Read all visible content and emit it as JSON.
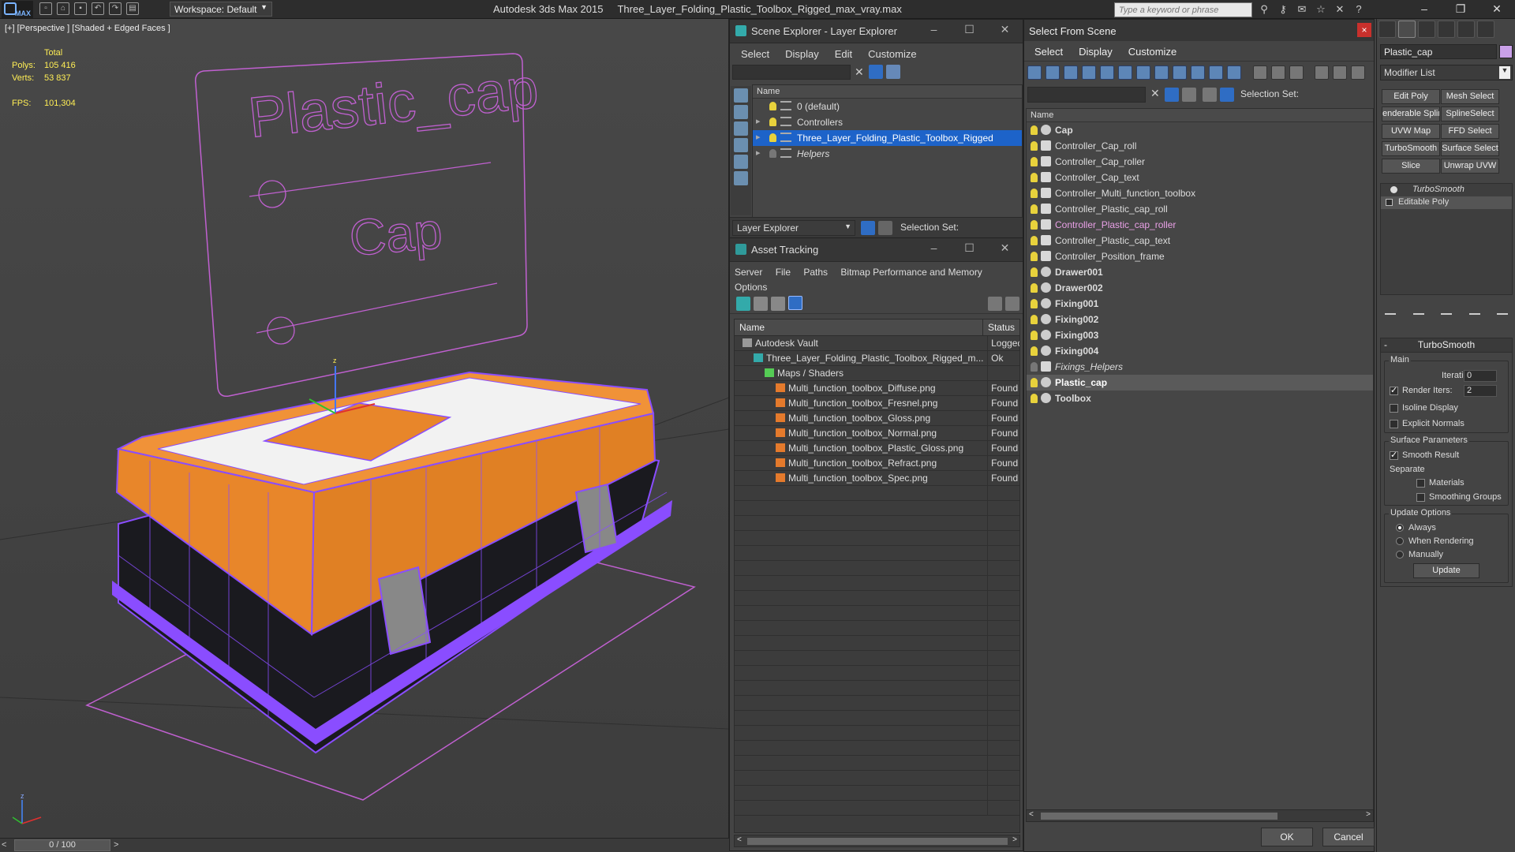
{
  "app": {
    "logo": "MAX",
    "workspace": "Workspace: Default",
    "title": "Autodesk 3ds Max  2015",
    "filename": "Three_Layer_Folding_Plastic_Toolbox_Rigged_max_vray.max",
    "search_placeholder": "Type a keyword or phrase"
  },
  "viewport": {
    "label": "[+] [Perspective ] [Shaded + Edged Faces ]",
    "stats": {
      "total_label": "Total",
      "polys_label": "Polys:",
      "polys": "105 416",
      "verts_label": "Verts:",
      "verts": "53 837",
      "fps_label": "FPS:",
      "fps": "101,304"
    },
    "board_title": "Plastic_cap",
    "board_sub": "Cap",
    "timeline": "0 / 100"
  },
  "scene_explorer": {
    "title": "Scene Explorer - Layer Explorer",
    "menu": [
      "Select",
      "Display",
      "Edit",
      "Customize"
    ],
    "col_name": "Name",
    "layers": [
      {
        "name": "0 (default)",
        "expand": ""
      },
      {
        "name": "Controllers",
        "expand": "▸"
      },
      {
        "name": "Three_Layer_Folding_Plastic_Toolbox_Rigged",
        "expand": "▸"
      },
      {
        "name": "Helpers",
        "expand": "▸"
      }
    ],
    "footer_combo": "Layer Explorer",
    "selection_set": "Selection Set:"
  },
  "asset_tracking": {
    "title": "Asset Tracking",
    "menu_row1": [
      "Server",
      "File",
      "Paths",
      "Bitmap Performance and Memory"
    ],
    "menu_row2": [
      "Options"
    ],
    "col_name": "Name",
    "col_status": "Status",
    "rows": [
      {
        "name": "Autodesk Vault",
        "status": "Logged",
        "indent": 1,
        "icon": "vault"
      },
      {
        "name": "Three_Layer_Folding_Plastic_Toolbox_Rigged_m...",
        "status": "Ok",
        "indent": 2,
        "icon": "file"
      },
      {
        "name": "Maps / Shaders",
        "status": "",
        "indent": 3,
        "icon": "folder"
      },
      {
        "name": "Multi_function_toolbox_Diffuse.png",
        "status": "Found",
        "indent": 4,
        "icon": "png"
      },
      {
        "name": "Multi_function_toolbox_Fresnel.png",
        "status": "Found",
        "indent": 4,
        "icon": "png"
      },
      {
        "name": "Multi_function_toolbox_Gloss.png",
        "status": "Found",
        "indent": 4,
        "icon": "png"
      },
      {
        "name": "Multi_function_toolbox_Normal.png",
        "status": "Found",
        "indent": 4,
        "icon": "png"
      },
      {
        "name": "Multi_function_toolbox_Plastic_Gloss.png",
        "status": "Found",
        "indent": 4,
        "icon": "png"
      },
      {
        "name": "Multi_function_toolbox_Refract.png",
        "status": "Found",
        "indent": 4,
        "icon": "png"
      },
      {
        "name": "Multi_function_toolbox_Spec.png",
        "status": "Found",
        "indent": 4,
        "icon": "png"
      }
    ]
  },
  "select_from_scene": {
    "title": "Select From Scene",
    "close": "×",
    "menu": [
      "Select",
      "Display",
      "Customize"
    ],
    "selection_set": "Selection Set:",
    "col_name": "Name",
    "objects": [
      {
        "name": "Cap",
        "style": "b",
        "type": "mesh"
      },
      {
        "name": "Controller_Cap_roll",
        "style": "",
        "type": "ctl"
      },
      {
        "name": "Controller_Cap_roller",
        "style": "",
        "type": "ctl"
      },
      {
        "name": "Controller_Cap_text",
        "style": "",
        "type": "ctl"
      },
      {
        "name": "Controller_Multi_function_toolbox",
        "style": "",
        "type": "ctl"
      },
      {
        "name": "Controller_Plastic_cap_roll",
        "style": "",
        "type": "ctl"
      },
      {
        "name": "Controller_Plastic_cap_roller",
        "style": "pk",
        "type": "ctl"
      },
      {
        "name": "Controller_Plastic_cap_text",
        "style": "",
        "type": "ctl"
      },
      {
        "name": "Controller_Position_frame",
        "style": "",
        "type": "ctl"
      },
      {
        "name": "Drawer001",
        "style": "b",
        "type": "mesh"
      },
      {
        "name": "Drawer002",
        "style": "b",
        "type": "mesh"
      },
      {
        "name": "Fixing001",
        "style": "b",
        "type": "mesh"
      },
      {
        "name": "Fixing002",
        "style": "b",
        "type": "mesh"
      },
      {
        "name": "Fixing003",
        "style": "b",
        "type": "mesh"
      },
      {
        "name": "Fixing004",
        "style": "b",
        "type": "mesh"
      },
      {
        "name": "Fixings_Helpers",
        "style": "it",
        "type": "ctl"
      },
      {
        "name": "Plastic_cap",
        "style": "hl",
        "type": "mesh"
      },
      {
        "name": "Toolbox",
        "style": "b",
        "type": "mesh"
      }
    ],
    "ok": "OK",
    "cancel": "Cancel"
  },
  "command_panel": {
    "object_name": "Plastic_cap",
    "object_color": "#c9a0e8",
    "modifier_list": "Modifier List",
    "buttons": [
      "Edit Poly",
      "Mesh Select",
      "enderable Splin",
      "SplineSelect",
      "UVW Map",
      "FFD Select",
      "TurboSmooth",
      "Surface Select",
      "Slice",
      "Unwrap UVW"
    ],
    "stack": [
      "TurboSmooth",
      "Editable Poly"
    ],
    "rollout_title": "TurboSmooth",
    "main_label": "Main",
    "iterations_label": "Iterations:",
    "iterations": "0",
    "render_iters_label": "Render Iters:",
    "render_iters": "2",
    "isoline": "Isoline Display",
    "explicit_normals": "Explicit Normals",
    "surface_params": "Surface Parameters",
    "smooth_result": "Smooth Result",
    "separate": "Separate",
    "materials": "Materials",
    "smoothing_groups": "Smoothing Groups",
    "update_options": "Update Options",
    "always": "Always",
    "when_rendering": "When Rendering",
    "manually": "Manually",
    "update": "Update"
  },
  "colors": {
    "accent_blue": "#1d63c9",
    "wire_purple": "#8a4dff",
    "orange": "#e8862a",
    "stats_yellow": "#ffee55"
  }
}
